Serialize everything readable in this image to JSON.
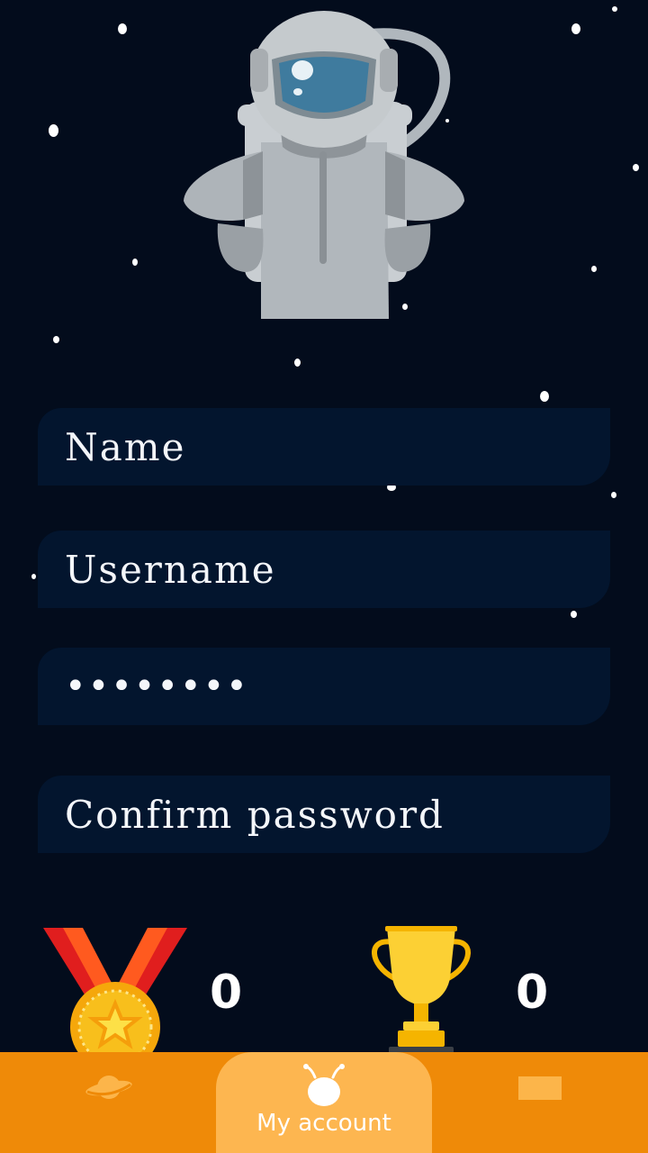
{
  "form": {
    "name_placeholder": "Name",
    "username_placeholder": "Username",
    "password_value": "••••••••",
    "confirm_placeholder": "Confirm password"
  },
  "stats": {
    "medals_count": "0",
    "trophies_count": "0"
  },
  "nav": {
    "items": [
      {
        "icon": "planet-icon",
        "label": ""
      },
      {
        "icon": "alien-icon",
        "label": "My account"
      },
      {
        "icon": "card-icon",
        "label": ""
      }
    ]
  },
  "colors": {
    "background": "#030c1c",
    "field": "#03152e",
    "navbar": "#ef8a08",
    "nav_active": "#fdb650"
  }
}
